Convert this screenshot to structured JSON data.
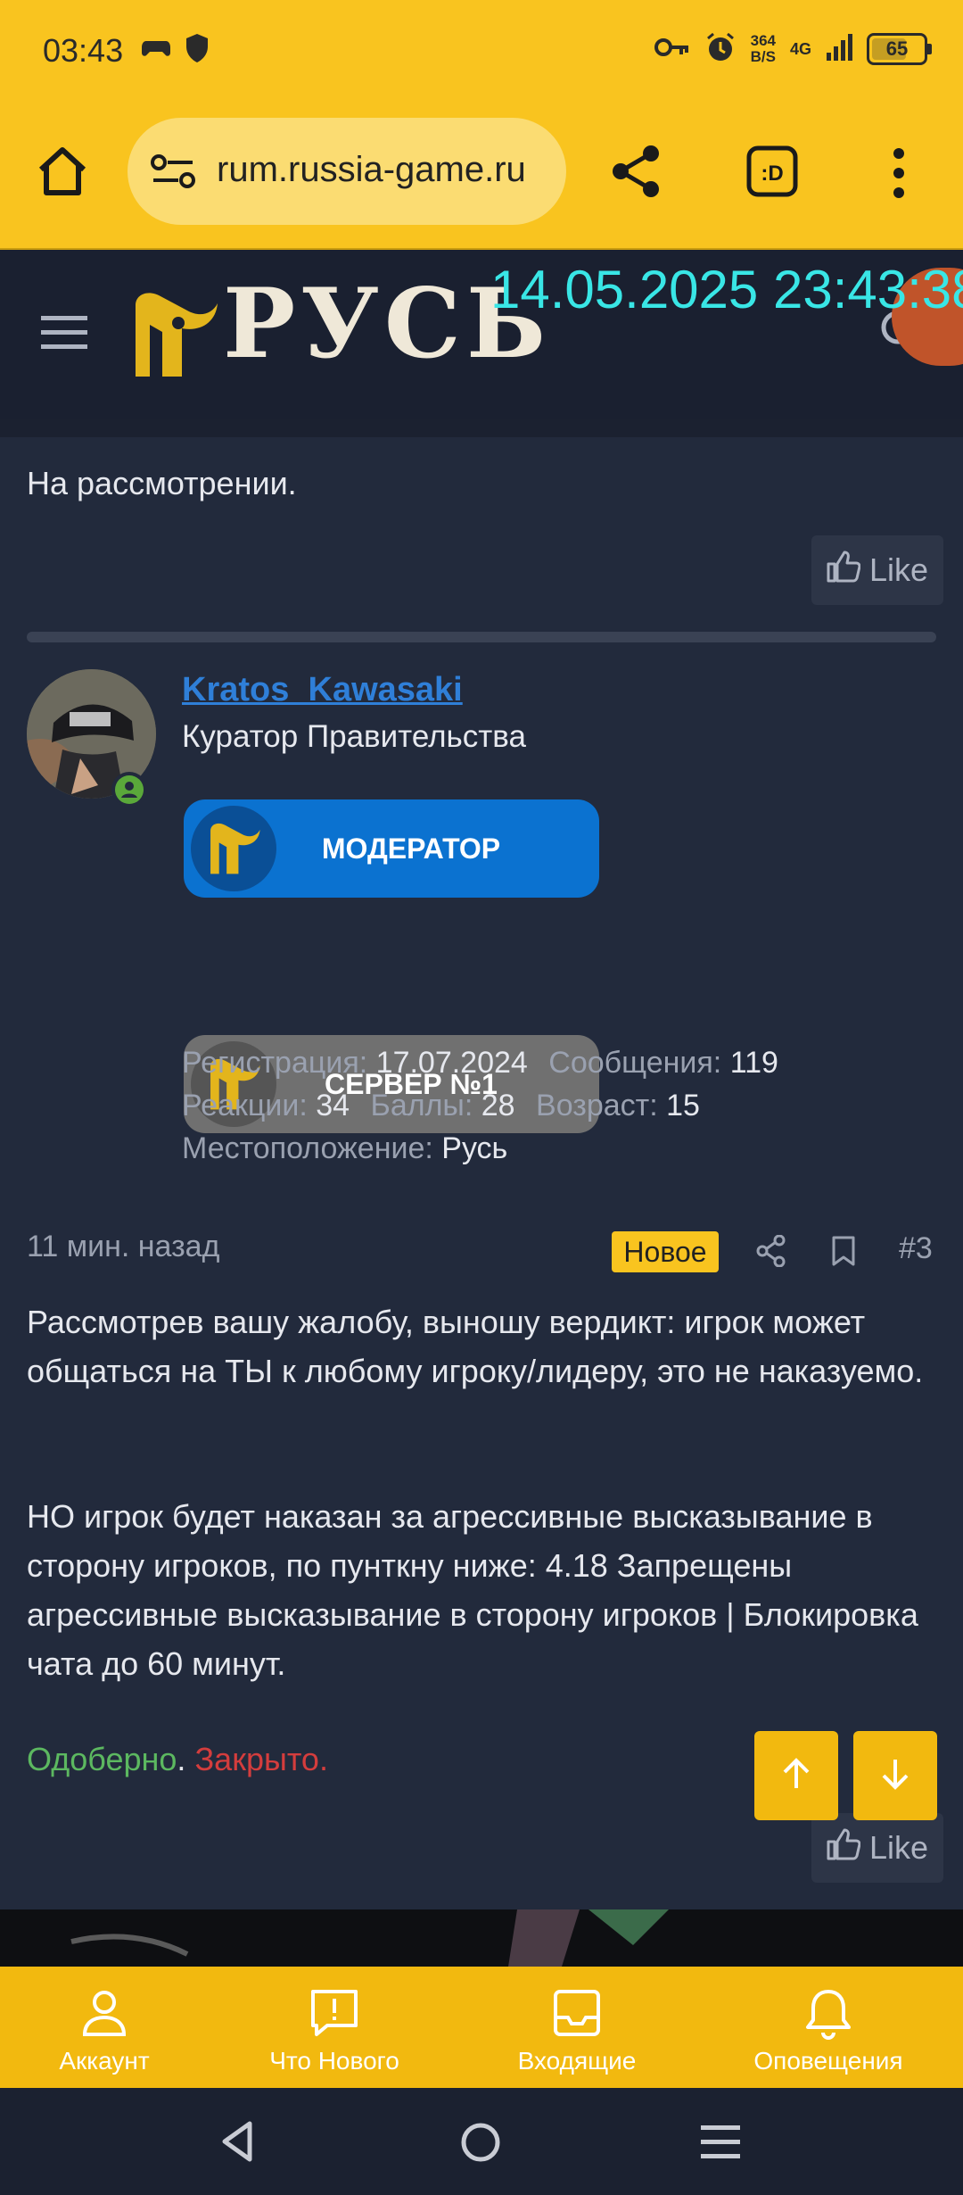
{
  "status_bar": {
    "time": "03:43",
    "net_speed": "364",
    "net_unit": "B/S",
    "network": "4G",
    "battery": "65"
  },
  "browser": {
    "url": "rum.russia-game.ru"
  },
  "forum_header": {
    "logo_text": "РУСЬ",
    "datetime": "14.05.2025 23:43:38"
  },
  "prev_post": {
    "text": "На рассмотрении.",
    "like_label": "Like"
  },
  "author": {
    "name": "Kratos_Kawasaki",
    "title": "Куратор Правительства",
    "badges": [
      "МОДЕРАТОР",
      "СЕРВЕР №1"
    ],
    "stats": {
      "registration_label": "Регистрация:",
      "registration_value": "17.07.2024",
      "messages_label": "Сообщения:",
      "messages_value": "119",
      "reactions_label": "Реакции:",
      "reactions_value": "34",
      "points_label": "Баллы:",
      "points_value": "28",
      "age_label": "Возраст:",
      "age_value": "15",
      "location_label": "Местоположение:",
      "location_value": "Русь"
    }
  },
  "post": {
    "time": "11 мин. назад",
    "new_label": "Новое",
    "number": "#3",
    "paragraph1": "Рассмотрев вашу жалобу, выношу вердикт: игрок может общаться на ТЫ к любому игроку/лидеру, это не наказуемо.",
    "paragraph2": "НО игрок будет наказан за агрессивные высказывание в сторону игроков, по пунткну ниже: 4.18 Запрещены агрессивные высказывание в сторону игроков | Блокировка чата до 60 минут.",
    "status_approved": "Одоберно",
    "status_sep": ".",
    "status_closed": "Закрыто.",
    "like_label": "Like"
  },
  "tabs": [
    {
      "label": "Аккаунт",
      "icon": "person-icon"
    },
    {
      "label": "Что Нового",
      "icon": "alert-bubble-icon"
    },
    {
      "label": "Входящие",
      "icon": "inbox-icon"
    },
    {
      "label": "Оповещения",
      "icon": "bell-icon"
    }
  ],
  "colors": {
    "accent_yellow": "#f9c41f",
    "moderator_blue": "#0b72d0",
    "server_gray": "#707070",
    "approved_green": "#5cb860",
    "closed_red": "#d43d3d",
    "username_blue": "#2f7fd8"
  }
}
